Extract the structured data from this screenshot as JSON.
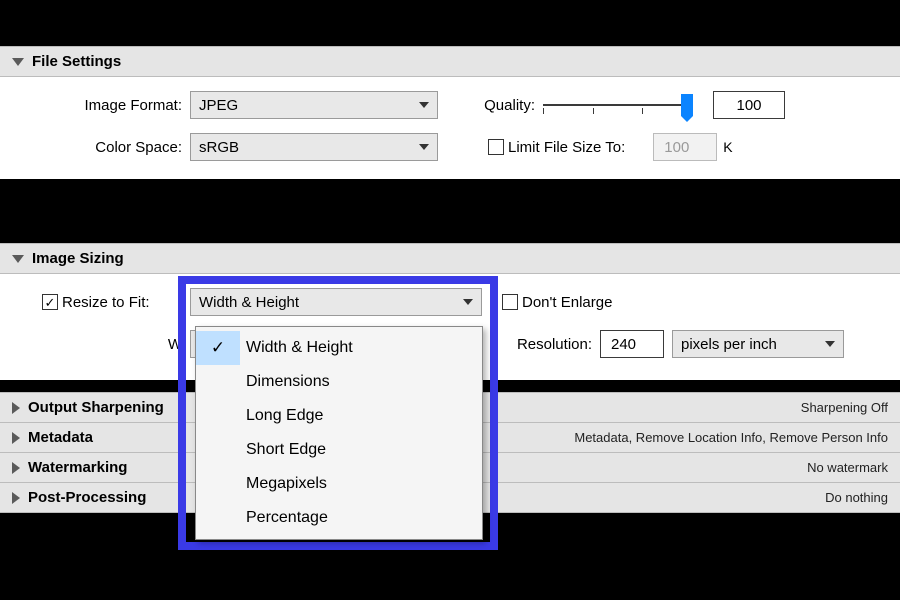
{
  "file_settings": {
    "title": "File Settings",
    "image_format": {
      "label": "Image Format:",
      "value": "JPEG"
    },
    "quality": {
      "label": "Quality:",
      "value": "100",
      "slider_pct": 100
    },
    "color_space": {
      "label": "Color Space:",
      "value": "sRGB"
    },
    "limit_file": {
      "label": "Limit File Size To:",
      "checked": false,
      "value": "100",
      "unit": "K"
    }
  },
  "image_sizing": {
    "title": "Image Sizing",
    "resize_to_fit": {
      "label": "Resize to Fit:",
      "checked": true,
      "value": "Width & Height"
    },
    "dont_enlarge": {
      "label": "Don't Enlarge",
      "checked": false
    },
    "w_label": "W",
    "resolution": {
      "label": "Resolution:",
      "value": "240",
      "unit": "pixels per inch"
    },
    "dropdown_options": [
      "Width & Height",
      "Dimensions",
      "Long Edge",
      "Short Edge",
      "Megapixels",
      "Percentage"
    ],
    "dropdown_selected_index": 0
  },
  "collapsed": {
    "output_sharpening": {
      "title": "Output Sharpening",
      "summary": "Sharpening Off"
    },
    "metadata": {
      "title": "Metadata",
      "summary": "Metadata, Remove Location Info, Remove Person Info"
    },
    "watermarking": {
      "title": "Watermarking",
      "summary": "No watermark"
    },
    "post_processing": {
      "title": "Post-Processing",
      "summary": "Do nothing"
    }
  }
}
